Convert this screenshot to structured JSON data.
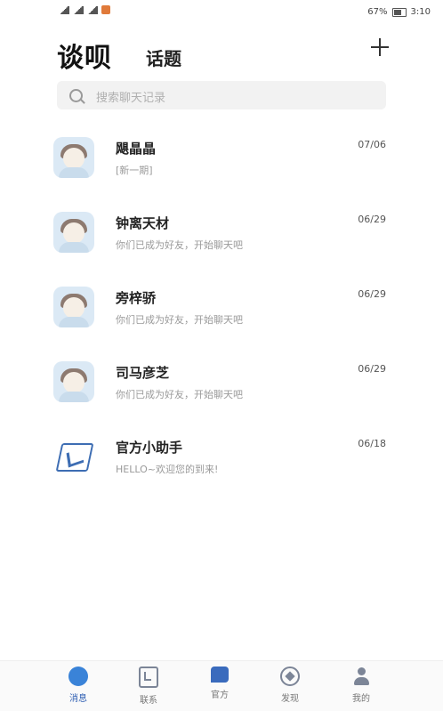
{
  "status_bar": {
    "battery": "67%",
    "time": "3:10"
  },
  "header": {
    "title": "谈呗",
    "tab": "话题"
  },
  "search": {
    "placeholder": "搜索聊天记录"
  },
  "conversations": [
    {
      "name": "飓晶晶",
      "preview": "[新一期]",
      "date": "07/06",
      "avatar": "user-avatar"
    },
    {
      "name": "钟离天材",
      "preview": "你们已成为好友，开始聊天吧",
      "date": "06/29",
      "avatar": "user-avatar"
    },
    {
      "name": "旁梓骄",
      "preview": "你们已成为好友，开始聊天吧",
      "date": "06/29",
      "avatar": "user-avatar"
    },
    {
      "name": "司马彦芝",
      "preview": "你们已成为好友，开始聊天吧",
      "date": "06/29",
      "avatar": "user-avatar"
    },
    {
      "name": "官方小助手",
      "preview": "HELLO~欢迎您的到来!",
      "date": "06/18",
      "avatar": "official-logo"
    }
  ],
  "tabbar": {
    "items": [
      {
        "label": "消息",
        "icon": "message-icon",
        "active": true
      },
      {
        "label": "联系",
        "icon": "contact-icon",
        "active": false
      },
      {
        "label": "官方",
        "icon": "official-icon",
        "active": false
      },
      {
        "label": "发现",
        "icon": "discover-icon",
        "active": false
      },
      {
        "label": "我的",
        "icon": "profile-icon",
        "active": false
      }
    ]
  },
  "colors": {
    "accent": "#3a83d8",
    "official_blue": "#3a6bbd"
  }
}
